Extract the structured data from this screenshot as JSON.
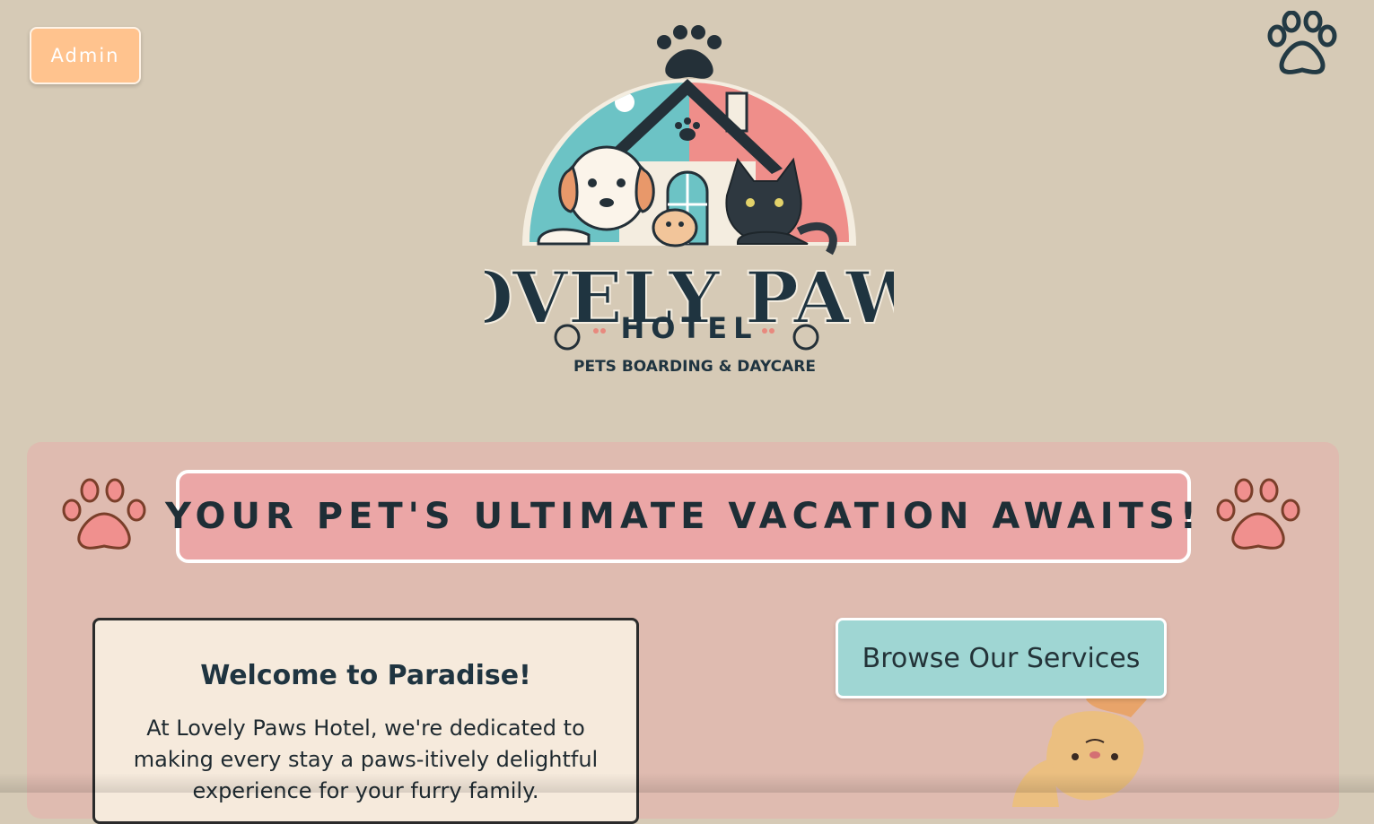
{
  "header": {
    "admin_label": "Admin",
    "logo": {
      "title": "LOVELY PAWS",
      "subtitle": "HOTEL",
      "tagline": "PETS BOARDING & DAYCARE"
    }
  },
  "banner": {
    "tagline": "YOUR PET'S ULTIMATE VACATION AWAITS!"
  },
  "welcome": {
    "title": "Welcome to Paradise!",
    "body": "At Lovely Paws Hotel, we're dedicated to making every stay a paws-itively delightful experience for your furry family."
  },
  "browse": {
    "label": "Browse Our Services"
  },
  "colors": {
    "page_bg": "#d6cab6",
    "admin_button": "#ffc38e",
    "panel": "#dfbbb0",
    "tagline_bg": "#eba6a6",
    "card_bg": "#f6eadc",
    "browse_button": "#9fd6d3",
    "dark_text": "#1e2e36"
  },
  "icons": [
    "paw-icon",
    "logo-image",
    "cat-illustration"
  ]
}
